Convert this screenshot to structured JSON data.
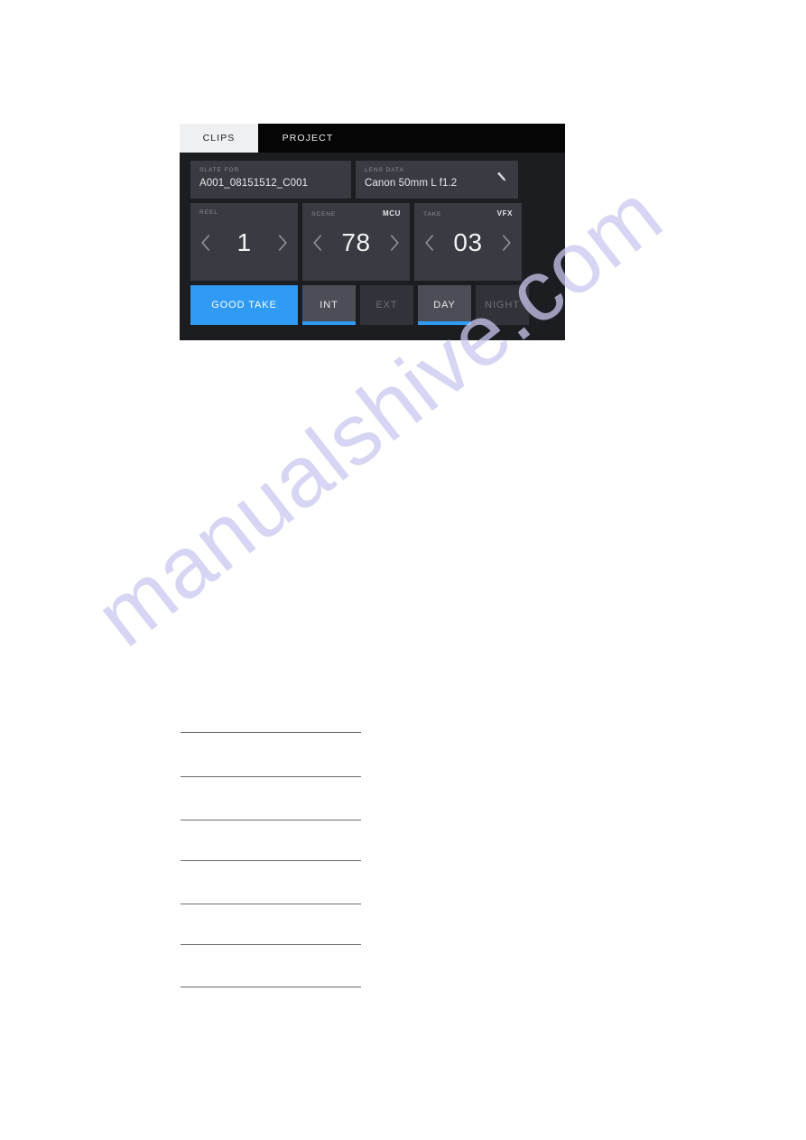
{
  "device": {
    "tabs": [
      {
        "label": "CLIPS",
        "state": "active"
      },
      {
        "label": "PROJECT",
        "state": "inactive"
      }
    ],
    "fields": [
      {
        "key": "slate_for",
        "label": "SLATE FOR",
        "value": "A001_08151512_C001",
        "edit_icon": "pencil-icon",
        "has_edit": false
      },
      {
        "key": "lens_data",
        "label": "LENS DATA",
        "value": "Canon 50mm L f1.2",
        "edit_icon": "pencil-icon",
        "has_edit": true
      }
    ],
    "steppers": [
      {
        "key": "reel",
        "label": "REEL",
        "badge": "",
        "value": "1",
        "prev_icon": "chevron-left-icon",
        "next_icon": "chevron-right-icon"
      },
      {
        "key": "scene",
        "label": "SCENE",
        "badge": "MCU",
        "value": "78",
        "prev_icon": "chevron-left-icon",
        "next_icon": "chevron-right-icon"
      },
      {
        "key": "take",
        "label": "TAKE",
        "badge": "VFX",
        "value": "03",
        "prev_icon": "chevron-left-icon",
        "next_icon": "chevron-right-icon"
      }
    ],
    "buttons": {
      "good_take": {
        "label": "GOOD TAKE",
        "state": "on"
      },
      "segments": [
        {
          "label": "INT",
          "state": "on"
        },
        {
          "label": "EXT",
          "state": "off"
        },
        {
          "label": "DAY",
          "state": "on"
        },
        {
          "label": "NIGHT",
          "state": "off"
        }
      ]
    },
    "colors": {
      "accent_blue": "#2f9bf5",
      "frame_black": "#17181c",
      "body_dark": "#1b1d21",
      "panel_gray": "#393a42",
      "segment_on": "#4c4e57",
      "segment_off": "#31333a",
      "tab_active_bg": "#eef0f1",
      "label_gray": "#8e9097"
    }
  },
  "watermark": {
    "text": "manualshive.com",
    "color": "#c9c8ef"
  },
  "page": {
    "rule_count": 7
  }
}
